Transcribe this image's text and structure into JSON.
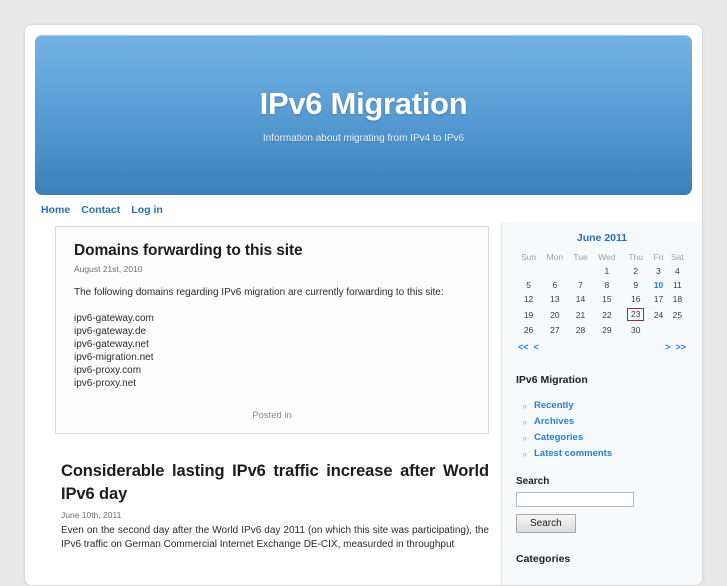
{
  "banner": {
    "title": "IPv6 Migration",
    "subtitle": "Information about migrating from IPv4 to IPv6",
    "gradient_top": "#73b2e2",
    "gradient_bottom": "#3c80b9"
  },
  "nav": {
    "items": [
      {
        "label": "Home"
      },
      {
        "label": "Contact"
      },
      {
        "label": "Log in"
      }
    ]
  },
  "posts": [
    {
      "title": "Domains forwarding to this site",
      "date": "August 21st, 2010",
      "intro": "The following domains regarding IPv6 migration are currently forwarding to this site:",
      "domains": [
        "ipv6-gateway.com",
        "ipv6-gateway.de",
        "ipv6-gateway.net",
        "ipv6-migration.net",
        "ipv6-proxy.com",
        "ipv6-proxy.net"
      ],
      "footer": "Posted in"
    },
    {
      "title": "Considerable lasting IPv6 traffic increase after World IPv6 day",
      "date": "June 10th, 2011",
      "body": "Even on the second day after the World IPv6 day 2011 (on which this site was participating), the IPv6 traffic on German Commercial Internet Exchange DE-CIX, measurded in throughput"
    }
  ],
  "sidebar": {
    "calendar": {
      "caption": "June 2011",
      "weekdays": [
        "Sun",
        "Mon",
        "Tue",
        "Wed",
        "Thu",
        "Fri",
        "Sat"
      ],
      "weeks": [
        [
          "",
          "",
          "",
          "1",
          "2",
          "3",
          "4"
        ],
        [
          "5",
          "6",
          "7",
          "8",
          "9",
          "10",
          "11"
        ],
        [
          "12",
          "13",
          "14",
          "15",
          "16",
          "17",
          "18"
        ],
        [
          "19",
          "20",
          "21",
          "22",
          "23",
          "24",
          "25"
        ],
        [
          "26",
          "27",
          "28",
          "29",
          "30",
          "",
          ""
        ]
      ],
      "linked_days": [
        "10"
      ],
      "today": "23",
      "today_border_color": "#9e2c2c",
      "link_color": "#1a7fd4",
      "nav": {
        "prev_year": "<<",
        "prev_month": "<",
        "next_month": ">",
        "next_year": ">>"
      }
    },
    "site_heading": "IPv6 Migration",
    "links": [
      {
        "label": "Recently"
      },
      {
        "label": "Archives"
      },
      {
        "label": "Categories"
      },
      {
        "label": "Latest comments"
      }
    ],
    "search": {
      "label": "Search",
      "value": "",
      "placeholder": "",
      "button_label": "Search"
    },
    "categories_heading": "Categories"
  }
}
